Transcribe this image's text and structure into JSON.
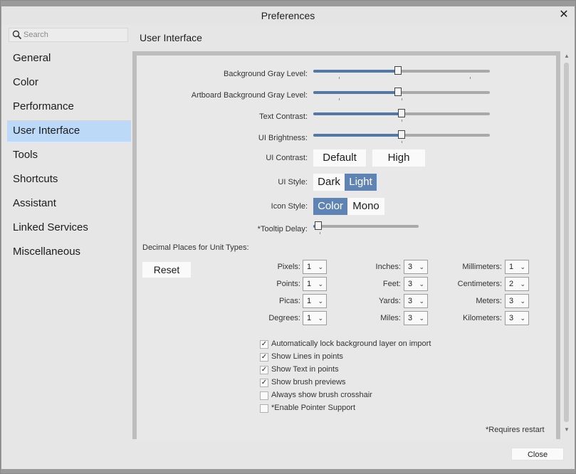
{
  "window": {
    "title": "Preferences",
    "close_glyph": "✕"
  },
  "search": {
    "placeholder": "Search"
  },
  "sidebar": {
    "items": [
      {
        "label": "General"
      },
      {
        "label": "Color"
      },
      {
        "label": "Performance"
      },
      {
        "label": "User Interface",
        "active": true
      },
      {
        "label": "Tools"
      },
      {
        "label": "Shortcuts"
      },
      {
        "label": "Assistant"
      },
      {
        "label": "Linked Services"
      },
      {
        "label": "Miscellaneous"
      }
    ]
  },
  "section_title": "User Interface",
  "sliders": {
    "background_gray": {
      "label": "Background Gray Level:",
      "value": 0.48
    },
    "artboard_gray": {
      "label": "Artboard Background Gray Level:",
      "value": 0.48
    },
    "text_contrast": {
      "label": "Text Contrast:",
      "value": 0.5
    },
    "ui_brightness": {
      "label": "UI Brightness:",
      "value": 0.5
    },
    "tooltip_delay": {
      "label": "*Tooltip Delay:",
      "value": 0.05
    }
  },
  "ui_contrast": {
    "label": "UI Contrast:",
    "default": "Default",
    "high": "High"
  },
  "ui_style": {
    "label": "UI Style:",
    "dark": "Dark",
    "light": "Light",
    "selected": "Light"
  },
  "icon_style": {
    "label": "Icon Style:",
    "color": "Color",
    "mono": "Mono",
    "selected": "Color"
  },
  "decimal": {
    "heading": "Decimal Places for Unit Types:",
    "reset": "Reset",
    "units": [
      {
        "label": "Pixels:",
        "value": "1"
      },
      {
        "label": "Points:",
        "value": "1"
      },
      {
        "label": "Picas:",
        "value": "1"
      },
      {
        "label": "Degrees:",
        "value": "1"
      },
      {
        "label": "Inches:",
        "value": "3"
      },
      {
        "label": "Feet:",
        "value": "3"
      },
      {
        "label": "Yards:",
        "value": "3"
      },
      {
        "label": "Miles:",
        "value": "3"
      },
      {
        "label": "Millimeters:",
        "value": "1"
      },
      {
        "label": "Centimeters:",
        "value": "2"
      },
      {
        "label": "Meters:",
        "value": "3"
      },
      {
        "label": "Kilometers:",
        "value": "3"
      }
    ]
  },
  "checkboxes": [
    {
      "label": "Automatically lock background layer on import",
      "checked": true
    },
    {
      "label": "Show Lines in points",
      "checked": true
    },
    {
      "label": "Show Text in points",
      "checked": true
    },
    {
      "label": "Show brush previews",
      "checked": true
    },
    {
      "label": "Always show brush crosshair",
      "checked": false
    },
    {
      "label": "*Enable Pointer Support",
      "checked": false
    }
  ],
  "check_glyph": "✓",
  "chevron_glyph": "⌄",
  "requires_restart": "*Requires restart",
  "close_button": "Close",
  "colors": {
    "accent": "#5f84b3",
    "slider_fill": "#5478a6",
    "active_nav": "#bcd9f7"
  }
}
